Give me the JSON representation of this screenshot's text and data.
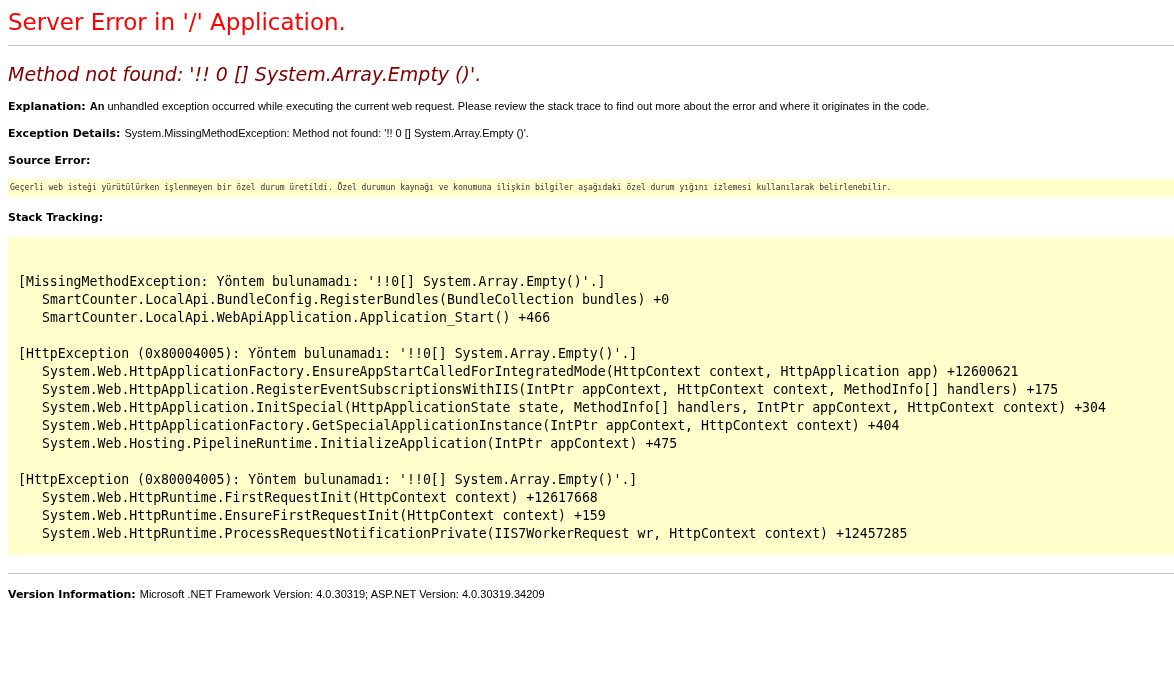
{
  "title": "Server Error in '/' Application.",
  "message": "Method not found: '!! 0 [] System.Array.Empty ()'.",
  "explanation": {
    "label": "Explanation:",
    "text": "**An** unhandled exception occurred while executing the current web request. Please review the stack trace to find out more about the error and where it originates in the code."
  },
  "exception_details": {
    "label": "Exception Details:",
    "text": "System.MissingMethodException: Method not found: '!! 0 [] System.Array.Empty ()'."
  },
  "source_error": {
    "label": "Source Error:",
    "text": "Geçerli web isteği yürütülürken işlenmeyen bir özel durum üretildi. Özel durumun kaynağı ve konumuna ilişkin bilgiler aşağıdaki özel durum yığını izlemesi kullanılarak belirlenebilir."
  },
  "stack_tracking": {
    "label": "Stack Tracking:",
    "groups": [
      {
        "exception": "[MissingMethodException: Yöntem bulunamadı: '!!0[] System.Array.Empty()'.]",
        "frames": [
          "SmartCounter.LocalApi.BundleConfig.RegisterBundles(BundleCollection bundles) +0",
          "SmartCounter.LocalApi.WebApiApplication.Application_Start() +466"
        ]
      },
      {
        "exception": "[HttpException (0x80004005): Yöntem bulunamadı: '!!0[] System.Array.Empty()'.]",
        "frames": [
          "System.Web.HttpApplicationFactory.EnsureAppStartCalledForIntegratedMode(HttpContext context, HttpApplication app) +12600621",
          "System.Web.HttpApplication.RegisterEventSubscriptionsWithIIS(IntPtr appContext, HttpContext context, MethodInfo[] handlers) +175",
          "System.Web.HttpApplication.InitSpecial(HttpApplicationState state, MethodInfo[] handlers, IntPtr appContext, HttpContext context) +304",
          "System.Web.HttpApplicationFactory.GetSpecialApplicationInstance(IntPtr appContext, HttpContext context) +404",
          "System.Web.Hosting.PipelineRuntime.InitializeApplication(IntPtr appContext) +475"
        ]
      },
      {
        "exception": "[HttpException (0x80004005): Yöntem bulunamadı: '!!0[] System.Array.Empty()'.]",
        "frames": [
          "System.Web.HttpRuntime.FirstRequestInit(HttpContext context) +12617668",
          "System.Web.HttpRuntime.EnsureFirstRequestInit(HttpContext context) +159",
          "System.Web.HttpRuntime.ProcessRequestNotificationPrivate(IIS7WorkerRequest wr, HttpContext context) +12457285"
        ]
      }
    ]
  },
  "version_information": {
    "label": "Version Information:",
    "text": "Microsoft .NET Framework Version: 4.0.30319; ASP.NET Version: 4.0.30319.34209"
  }
}
